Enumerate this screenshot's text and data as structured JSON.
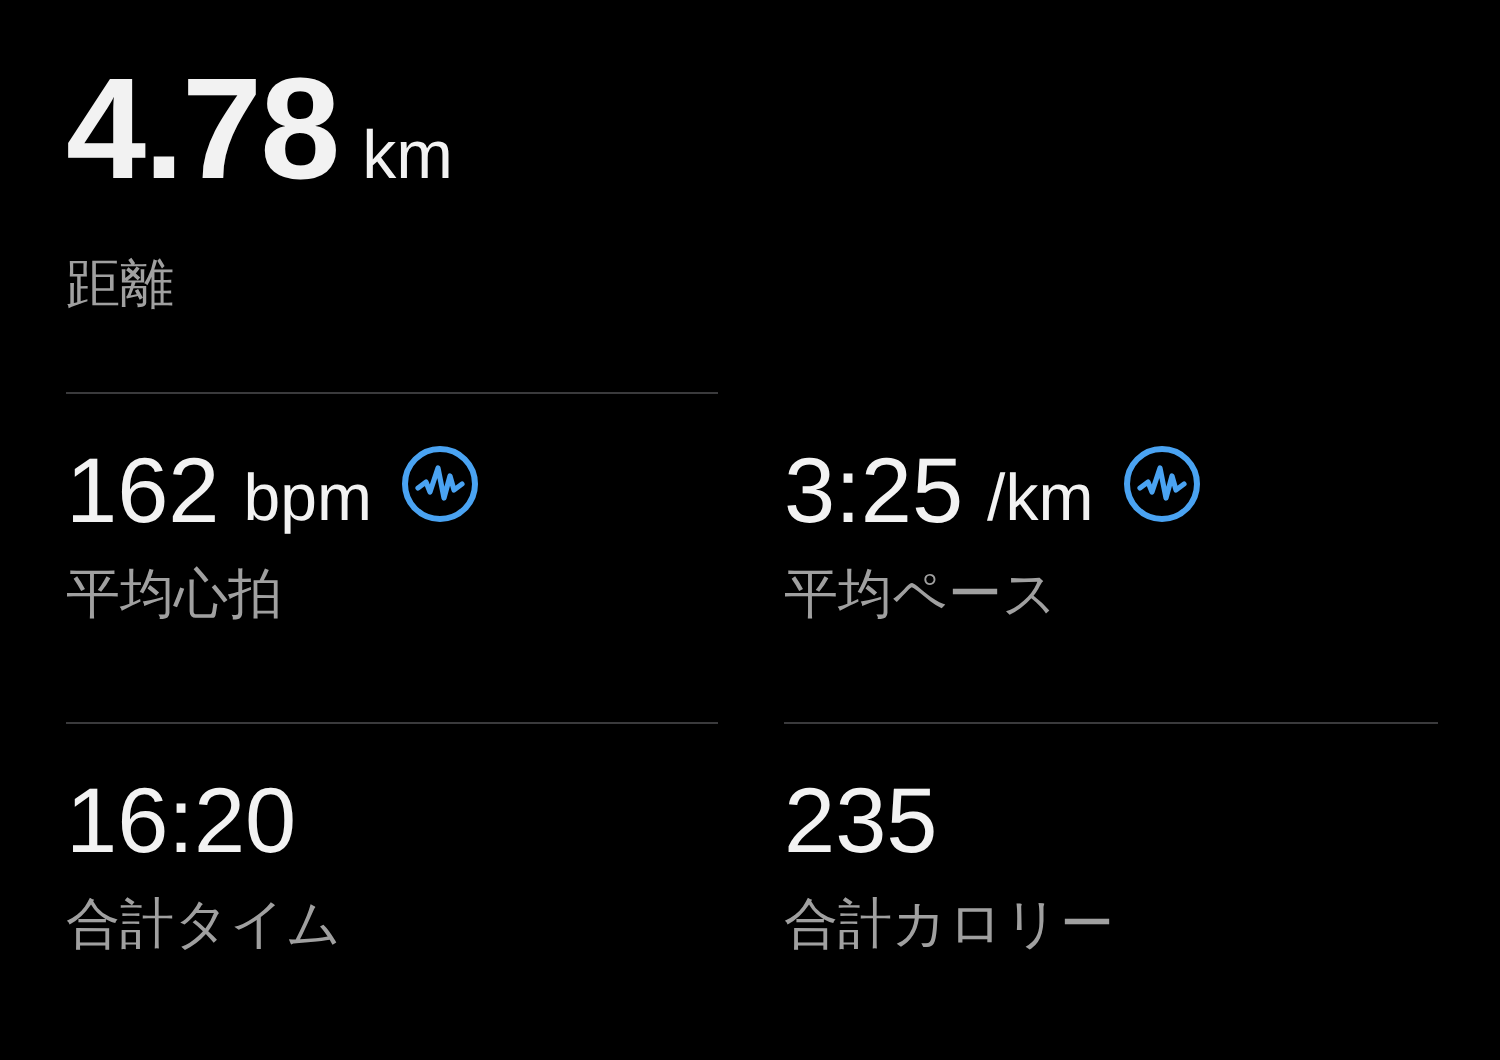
{
  "summary": {
    "value": "4.78",
    "unit": "km",
    "label": "距離"
  },
  "metrics": [
    {
      "value": "162",
      "unit": "bpm",
      "label": "平均心拍",
      "detail_icon": true
    },
    {
      "value": "3:25",
      "unit": "/km",
      "label": "平均ペース",
      "detail_icon": true
    },
    {
      "value": "16:20",
      "label": "合計タイム",
      "detail_icon": false
    },
    {
      "value": "235",
      "label": "合計カロリー",
      "detail_icon": false
    }
  ]
}
